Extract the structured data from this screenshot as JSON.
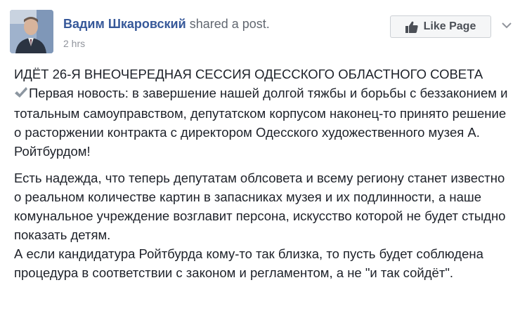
{
  "post": {
    "author": "Вадим Шкаровский",
    "action": "shared a post.",
    "timestamp": "2 hrs",
    "like_button_label": "Like Page"
  },
  "body": {
    "title_line": "ИДЁТ 26-Я ВНЕОЧЕРЕДНАЯ СЕССИЯ ОДЕССКОГО ОБЛАСТНОГО СОВЕТА",
    "news_item": "Первая новость: в завершение нашей долгой тяжбы и борьбы с беззаконием и тотальным самоуправством, депутатском корпусом наконец-то принято решение о расторжении контракта с директором Одесского художественного музея А. Ройтбурдом!",
    "paragraph_1": "Есть надежда, что теперь депутатам облсовета и всему региону станет известно о реальном количестве картин в запасниках музея и их подлинности, а наше комунальное учреждение возглавит персона, искусство которой не будет стыдно показать детям.",
    "paragraph_2": "А если кандидатура Ройтбурда кому-то так близка, то пусть будет соблюдена процедура в соответствии с законом и регламентом, а не \"и так сойдёт\"."
  },
  "icons": {
    "like": "thumbs-up-icon",
    "more": "chevron-down-icon",
    "check": "check-mark-icon"
  },
  "colors": {
    "link": "#365899",
    "secondary_text": "#90949c",
    "body_text": "#1d2129",
    "button_bg": "#f5f6f7",
    "button_border": "#ccd0d5"
  }
}
